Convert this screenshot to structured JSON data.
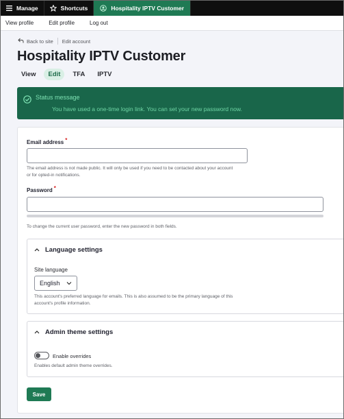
{
  "toolbar": {
    "manage": "Manage",
    "shortcuts": "Shortcuts",
    "user_tab": "Hospitality IPTV Customer"
  },
  "tray": {
    "links": [
      "View profile",
      "Edit profile",
      "Log out"
    ]
  },
  "breadcrumb": {
    "back": "Back to site",
    "current": "Edit account"
  },
  "page": {
    "title": "Hospitality IPTV Customer",
    "tabs": [
      {
        "label": "View",
        "active": false
      },
      {
        "label": "Edit",
        "active": true
      },
      {
        "label": "TFA",
        "active": false
      },
      {
        "label": "IPTV",
        "active": false
      }
    ]
  },
  "status": {
    "title": "Status message",
    "text": "You have used a one-time login link. You can set your new password now."
  },
  "form": {
    "email": {
      "label": "Email address",
      "required_mark": "*",
      "value": "",
      "description_line1": "The email address is not made public. It will only be used if you need to be contacted about your account",
      "description_line2": "or for opted-in notifications."
    },
    "password": {
      "label": "Password",
      "required_mark": "*",
      "value": "",
      "description": "To change the current user password, enter the new password in both fields."
    },
    "language": {
      "summary": "Language settings",
      "site_language_label": "Site language",
      "selected": "English",
      "description_line1": "This account's preferred language for emails. This is also assumed to be the primary language of this",
      "description_line2": "account's profile information."
    },
    "admin_theme": {
      "summary": "Admin theme settings",
      "toggle_label": "Enable overrides",
      "toggle_on": false,
      "description": "Enables default admin theme overrides."
    },
    "save_label": "Save"
  },
  "colors": {
    "toolbar_bg": "#0f0f0f",
    "accent_green": "#1f7a54",
    "status_bg": "#19664a",
    "status_text": "#6fd6a5",
    "required_red": "#d72222"
  }
}
